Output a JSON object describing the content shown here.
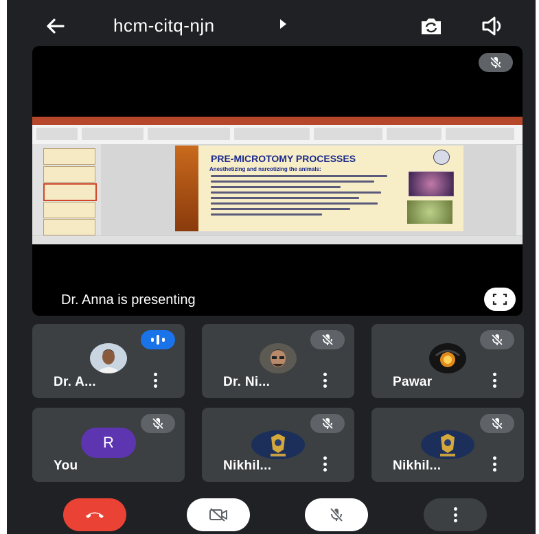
{
  "header": {
    "meeting_code": "hcm-citq-njn",
    "icons": [
      "back-arrow-icon",
      "caret-right-icon",
      "switch-camera-icon",
      "speaker-icon"
    ]
  },
  "presentation": {
    "presenter_text": "Dr. Anna is presenting",
    "slide_title": "PRE-MICROTOMY PROCESSES",
    "slide_subtitle": "Anesthetizing and narcotizing the animals:",
    "icons": [
      "mic-off-icon",
      "fullscreen-icon"
    ]
  },
  "participants": [
    {
      "name": "Dr. A...",
      "status": "speaking",
      "avatar": "photo"
    },
    {
      "name": "Dr. Ni...",
      "status": "muted",
      "avatar": "photo"
    },
    {
      "name": "Pawar",
      "status": "muted",
      "avatar": "photo"
    },
    {
      "name": "You",
      "status": "muted",
      "avatar_letter": "R"
    },
    {
      "name": "Nikhil...",
      "status": "muted",
      "avatar": "emblem"
    },
    {
      "name": "Nikhil...",
      "status": "muted",
      "avatar": "emblem"
    }
  ],
  "controls": {
    "icons": [
      "end-call-icon",
      "camera-off-icon",
      "mic-off-icon",
      "more-options-icon"
    ]
  },
  "colors": {
    "background": "#202124",
    "tile": "#3c4043",
    "end_call": "#ea4335",
    "speaking": "#1a73e8",
    "avatar_purple": "#5e35b1"
  }
}
